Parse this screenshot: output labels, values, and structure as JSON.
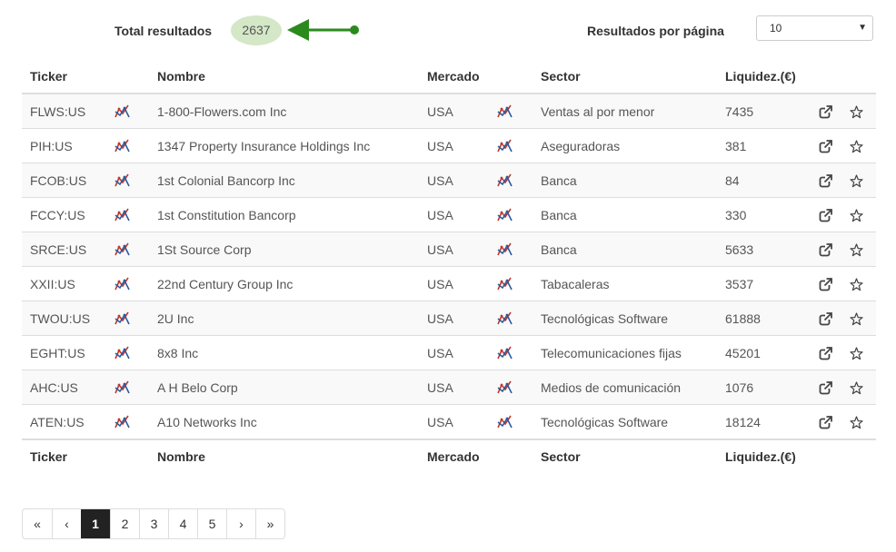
{
  "summary": {
    "total_label": "Total resultados",
    "total_value": "2637"
  },
  "per_page": {
    "label": "Resultados por página",
    "selected": "10"
  },
  "columns": {
    "ticker": "Ticker",
    "name": "Nombre",
    "market": "Mercado",
    "sector": "Sector",
    "liquidity": "Liquidez.(€)"
  },
  "rows": [
    {
      "ticker": "FLWS:US",
      "name": "1-800-Flowers.com Inc",
      "market": "USA",
      "sector": "Ventas al por menor",
      "liquidity": "7435"
    },
    {
      "ticker": "PIH:US",
      "name": "1347 Property Insurance Holdings Inc",
      "market": "USA",
      "sector": "Aseguradoras",
      "liquidity": "381"
    },
    {
      "ticker": "FCOB:US",
      "name": "1st Colonial Bancorp Inc",
      "market": "USA",
      "sector": "Banca",
      "liquidity": "84"
    },
    {
      "ticker": "FCCY:US",
      "name": "1st Constitution Bancorp",
      "market": "USA",
      "sector": "Banca",
      "liquidity": "330"
    },
    {
      "ticker": "SRCE:US",
      "name": "1St Source Corp",
      "market": "USA",
      "sector": "Banca",
      "liquidity": "5633"
    },
    {
      "ticker": "XXII:US",
      "name": "22nd Century Group Inc",
      "market": "USA",
      "sector": "Tabacaleras",
      "liquidity": "3537"
    },
    {
      "ticker": "TWOU:US",
      "name": "2U Inc",
      "market": "USA",
      "sector": "Tecnológicas Software",
      "liquidity": "61888"
    },
    {
      "ticker": "EGHT:US",
      "name": "8x8 Inc",
      "market": "USA",
      "sector": "Telecomunicaciones fijas",
      "liquidity": "45201"
    },
    {
      "ticker": "AHC:US",
      "name": "A H Belo Corp",
      "market": "USA",
      "sector": "Medios de comunicación",
      "liquidity": "1076"
    },
    {
      "ticker": "ATEN:US",
      "name": "A10 Networks Inc",
      "market": "USA",
      "sector": "Tecnológicas Software",
      "liquidity": "18124"
    }
  ],
  "icons": {
    "chart": "chart-lines-icon",
    "open": "external-link-icon",
    "favorite": "star-icon"
  },
  "pagination": {
    "first": "«",
    "prev": "‹",
    "pages": [
      {
        "label": "1",
        "active": true
      },
      {
        "label": "2",
        "active": false
      },
      {
        "label": "3",
        "active": false
      },
      {
        "label": "4",
        "active": false
      },
      {
        "label": "5",
        "active": false
      }
    ],
    "next": "›",
    "last": "»"
  },
  "colors": {
    "badge_bg": "#d4e7c7",
    "arrow": "#2b8a1e",
    "active_page": "#222222"
  }
}
